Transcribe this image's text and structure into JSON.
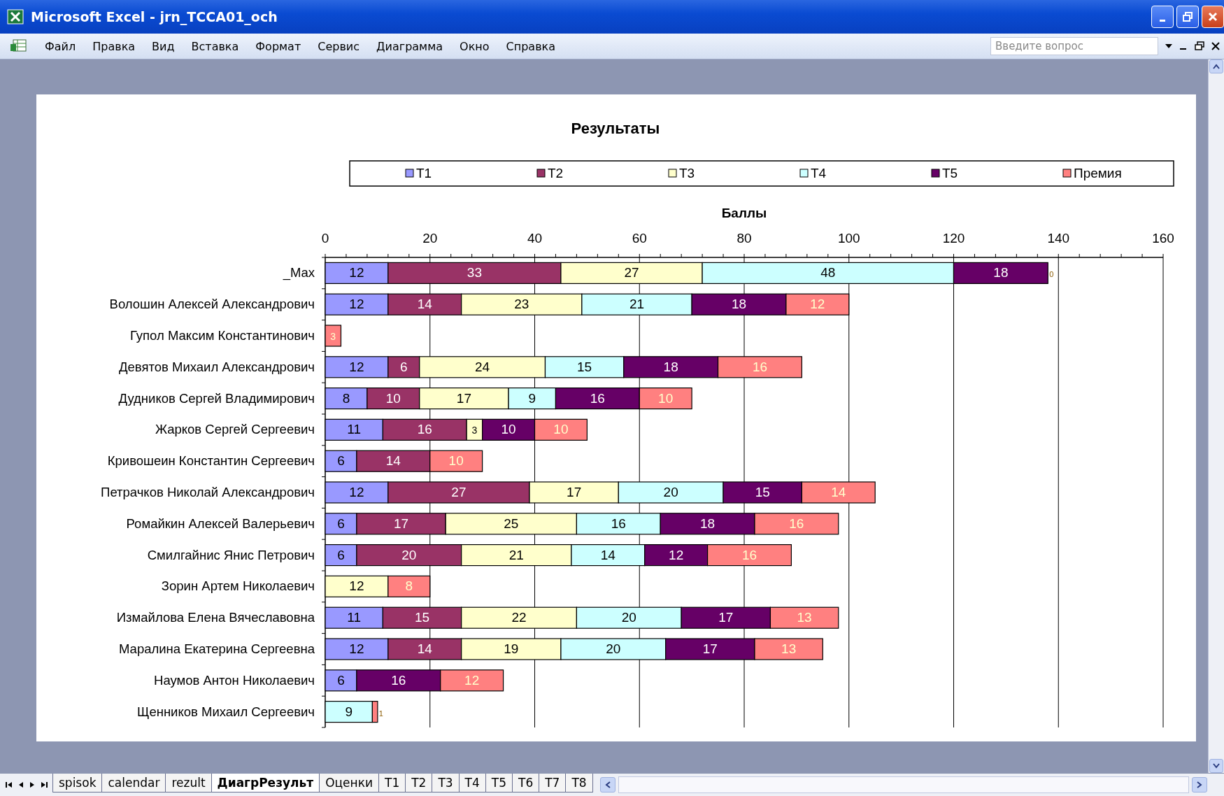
{
  "window": {
    "title": "Microsoft Excel - jrn_TCCA01_och"
  },
  "menu": [
    "Файл",
    "Правка",
    "Вид",
    "Вставка",
    "Формат",
    "Сервис",
    "Диаграмма",
    "Окно",
    "Справка"
  ],
  "help_search": {
    "placeholder": "Введите вопрос"
  },
  "chart": {
    "chart_data": {
      "type": "bar",
      "orientation": "horizontal",
      "stacked": true,
      "legend": "top",
      "grid": true,
      "value_labels": [
        [
          "12",
          "12",
          null,
          "12",
          "8",
          "11",
          "6",
          "12",
          "6",
          "6",
          null,
          "11",
          "12",
          "6",
          null
        ],
        [
          "33",
          "14",
          null,
          "6",
          "10",
          "16",
          "14",
          "27",
          "17",
          "20",
          null,
          "15",
          "14",
          null,
          null
        ],
        [
          "27",
          "23",
          null,
          "24",
          "17",
          "3",
          null,
          "17",
          "25",
          "21",
          "12",
          "22",
          "19",
          null,
          null
        ],
        [
          "48",
          "21",
          null,
          "15",
          "9",
          null,
          null,
          "20",
          "16",
          "14",
          null,
          "20",
          "20",
          null,
          "9"
        ],
        [
          "18",
          "18",
          null,
          "18",
          "16",
          "10",
          null,
          "15",
          "18",
          "12",
          null,
          "17",
          "17",
          "16",
          null
        ],
        [
          "0",
          "12",
          "3",
          "16",
          "10",
          "10",
          "10",
          "14",
          "16",
          "16",
          "8",
          "13",
          "13",
          "12",
          "1"
        ]
      ],
      "title": "Результаты",
      "xlabel": "Баллы",
      "xlim": [
        0,
        160
      ],
      "xticks": [
        0,
        20,
        40,
        60,
        80,
        100,
        120,
        140,
        160
      ],
      "categories": [
        "_Max",
        "Волошин Алексей Александрович",
        "Гупол Максим Константинович",
        "Девятов Михаил Александрович",
        "Дудников Сергей Владимирович",
        "Жарков Сергей Сергеевич",
        "Кривошеин Константин Сергеевич",
        "Петрачков Николай Александрович",
        "Ромайкин Алексей Валерьевич",
        "Смилгайнис Янис Петрович",
        "Зорин Артем Николаевич",
        "Измайлова Елена Вячеславовна",
        "Маралина Екатерина Сергеевна",
        "Наумов Антон Николаевич",
        "Щенников Михаил Сергеевич"
      ],
      "series": [
        {
          "name": "T1",
          "color": "#9999ff",
          "values": [
            12,
            12,
            0,
            12,
            8,
            11,
            6,
            12,
            6,
            6,
            0,
            11,
            12,
            6,
            0
          ]
        },
        {
          "name": "T2",
          "color": "#993366",
          "values": [
            33,
            14,
            0,
            6,
            10,
            16,
            14,
            27,
            17,
            20,
            0,
            15,
            14,
            0,
            0
          ]
        },
        {
          "name": "T3",
          "color": "#ffffcc",
          "values": [
            27,
            23,
            0,
            24,
            17,
            3,
            0,
            17,
            25,
            21,
            12,
            22,
            19,
            0,
            0
          ]
        },
        {
          "name": "T4",
          "color": "#ccffff",
          "values": [
            48,
            21,
            0,
            15,
            9,
            0,
            0,
            20,
            16,
            14,
            0,
            20,
            20,
            0,
            9
          ]
        },
        {
          "name": "T5",
          "color": "#660066",
          "values": [
            18,
            18,
            0,
            18,
            16,
            10,
            0,
            15,
            18,
            12,
            0,
            17,
            17,
            16,
            0
          ]
        },
        {
          "name": "Премия",
          "color": "#ff8080",
          "values": [
            0,
            12,
            3,
            16,
            10,
            10,
            10,
            14,
            16,
            16,
            8,
            13,
            13,
            12,
            1
          ]
        }
      ]
    }
  },
  "sheet_tabs": [
    {
      "label": "spisok",
      "selected": false
    },
    {
      "label": "calendar",
      "selected": false
    },
    {
      "label": "rezult",
      "selected": false
    },
    {
      "label": "ДиагрРезульт",
      "selected": true
    },
    {
      "label": "Оценки",
      "selected": false
    },
    {
      "label": "T1",
      "selected": false
    },
    {
      "label": "T2",
      "selected": false
    },
    {
      "label": "T3",
      "selected": false
    },
    {
      "label": "T4",
      "selected": false
    },
    {
      "label": "T5",
      "selected": false
    },
    {
      "label": "T6",
      "selected": false
    },
    {
      "label": "T7",
      "selected": false
    },
    {
      "label": "T8",
      "selected": false
    }
  ]
}
